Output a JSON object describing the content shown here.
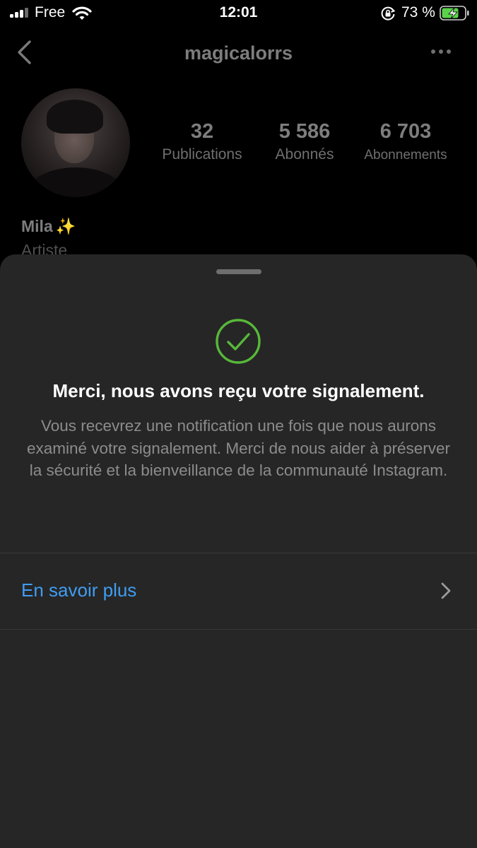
{
  "status_bar": {
    "carrier": "Free",
    "time": "12:01",
    "battery_percent": "73 %",
    "battery_level": 0.73,
    "icons": [
      "signal-icon",
      "wifi-icon",
      "rotation-lock-icon",
      "battery-charging-icon"
    ]
  },
  "profile": {
    "username": "magicalorrs",
    "stats": [
      {
        "value": "32",
        "label": "Publications"
      },
      {
        "value": "5 586",
        "label": "Abonnés"
      },
      {
        "value": "6 703",
        "label": "Abonnements"
      }
    ],
    "display_name": "Mila",
    "display_name_emoji": "✨",
    "category": "Artiste"
  },
  "sheet": {
    "title": "Merci, nous avons reçu votre signalement.",
    "body": "Vous recevrez une notification une fois que nous aurons examiné votre signalement. Merci de nous aider à préserver la sécurité et la bienveillance de la communauté Instagram.",
    "link_label": "En savoir plus",
    "colors": {
      "sheet_bg": "#262626",
      "check": "#57b83a",
      "link": "#3f9df3"
    }
  }
}
